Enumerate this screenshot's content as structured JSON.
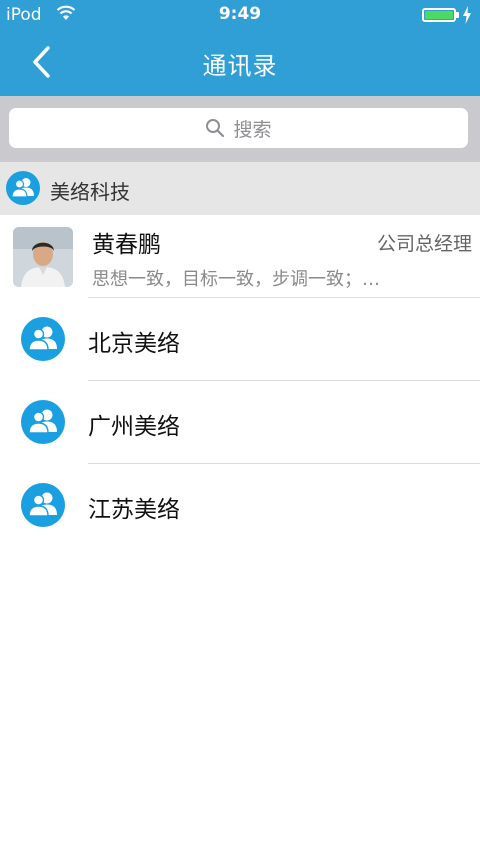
{
  "status_bar": {
    "carrier": "iPod",
    "time": "9:49",
    "battery_level": 1.0,
    "charging": true
  },
  "nav": {
    "title": "通讯录",
    "back_icon": "chevron-left-icon"
  },
  "search": {
    "placeholder": "搜索",
    "icon": "search-icon"
  },
  "group": {
    "title": "美络科技",
    "icon": "contacts-group-icon"
  },
  "person": {
    "name": "黄春鹏",
    "role": "公司总经理",
    "motto": "思想一致，目标一致，步调一致；…"
  },
  "departments": [
    {
      "label": "北京美络"
    },
    {
      "label": "广州美络"
    },
    {
      "label": "江苏美络"
    }
  ],
  "colors": {
    "nav_blue": "#2f9fd6",
    "icon_blue": "#1aa0e0",
    "search_bg": "#c9c9ce",
    "group_bg": "#e6e6e6",
    "battery_green": "#4cd964"
  }
}
